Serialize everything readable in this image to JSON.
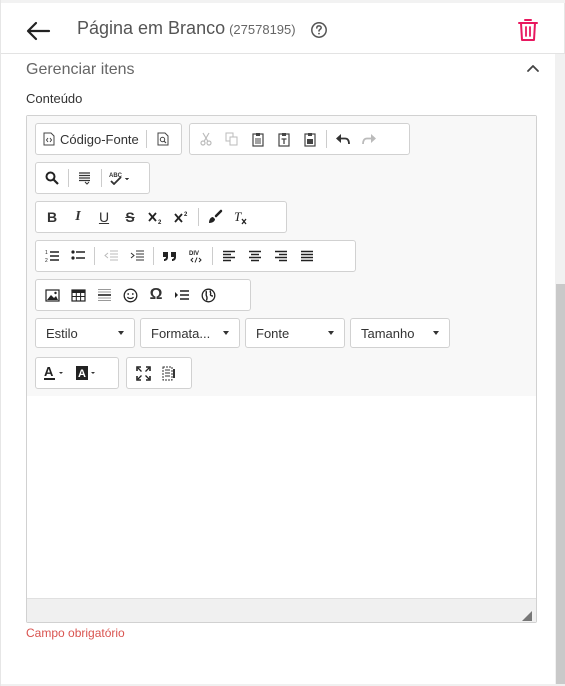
{
  "header": {
    "title": "Página em Branco",
    "id": "(27578195)",
    "back_icon": "arrow-left-icon",
    "help_icon": "question-circle-icon",
    "delete_icon": "trash-icon",
    "delete_color": "#e8185f"
  },
  "section": {
    "title": "Gerenciar itens",
    "field_label": "Conteúdo",
    "error_text": "Campo obrigatório",
    "error_color": "#d9534f"
  },
  "editor": {
    "source_label": "Código-Fonte",
    "combos": {
      "style": "Estilo",
      "format": "Formata...",
      "font": "Fonte",
      "size": "Tamanho"
    }
  }
}
